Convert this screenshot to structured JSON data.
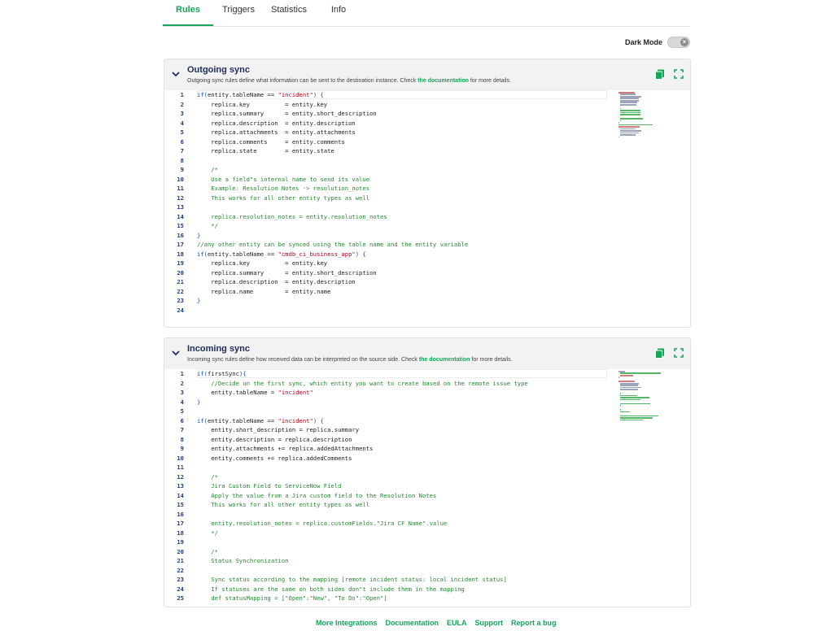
{
  "tabs": [
    {
      "label": "Rules",
      "active": true
    },
    {
      "label": "Triggers",
      "active": false
    },
    {
      "label": "Statistics",
      "active": false
    },
    {
      "label": "Info",
      "active": false
    }
  ],
  "dark_mode": {
    "label": "Dark Mode",
    "on": false
  },
  "accent_color": "#17a45b",
  "outgoing": {
    "title": "Outgoing sync",
    "desc_before": "Outgoing sync rules define what information can be sent to the destination instance. Check ",
    "desc_link": "the documentation",
    "desc_after": " for more details.",
    "lines": [
      [
        [
          "kw",
          "if("
        ],
        [
          "",
          "entity.tableName == "
        ],
        [
          "str",
          "\"incident\""
        ],
        [
          "kw",
          ") {"
        ]
      ],
      [
        [
          "",
          "    replica.key          = entity.key"
        ]
      ],
      [
        [
          "",
          "    replica.summary      = entity.short_description"
        ]
      ],
      [
        [
          "",
          "    replica.description  = entity.description"
        ]
      ],
      [
        [
          "",
          "    replica.attachments  = entity.attachments"
        ]
      ],
      [
        [
          "",
          "    replica.comments     = entity.comments"
        ]
      ],
      [
        [
          "",
          "    replica.state        = entity.state"
        ]
      ],
      [],
      [
        [
          "cm",
          "    /*"
        ]
      ],
      [
        [
          "cm",
          "    Use a field\"s internal name to send its value"
        ]
      ],
      [
        [
          "cm",
          "    Example: Resolution Notes -> resolution_notes"
        ]
      ],
      [
        [
          "cm",
          "    This works for all other entity types as well"
        ]
      ],
      [],
      [
        [
          "cm",
          "    replica.resolution_notes = entity.resolution_notes"
        ]
      ],
      [
        [
          "cm",
          "    */"
        ]
      ],
      [
        [
          "kw",
          "}"
        ]
      ],
      [
        [
          "cm",
          "//any other entity can be synced using the table name and the entity variable"
        ]
      ],
      [
        [
          "kw",
          "if("
        ],
        [
          "",
          "entity.tableName == "
        ],
        [
          "str",
          "\"cmdb_ci_business_app\""
        ],
        [
          "kw",
          ") {"
        ]
      ],
      [
        [
          "",
          "    replica.key          = entity.key"
        ]
      ],
      [
        [
          "",
          "    replica.summary      = entity.short_description"
        ]
      ],
      [
        [
          "",
          "    replica.description  = entity.description"
        ]
      ],
      [
        [
          "",
          "    replica.name         = entity.name"
        ]
      ],
      [
        [
          "kw",
          "}"
        ]
      ],
      []
    ]
  },
  "incoming": {
    "title": "Incoming sync",
    "desc_before": "Incoming sync rules define how received data can be interpreted on the source side. Check ",
    "desc_link": "the documentation",
    "desc_after": " for more details.",
    "lines": [
      [
        [
          "kw",
          "if("
        ],
        [
          "",
          "firstSync"
        ],
        [
          "kw",
          "){"
        ]
      ],
      [
        [
          "cm",
          "    //Decide on the first sync, which entity you want to create based on the remote issue type"
        ]
      ],
      [
        [
          "",
          "    entity.tableName = "
        ],
        [
          "str",
          "\"incident\""
        ]
      ],
      [
        [
          "kw",
          "}"
        ]
      ],
      [],
      [
        [
          "kw",
          "if("
        ],
        [
          "",
          "entity.tableName == "
        ],
        [
          "str",
          "\"incident\""
        ],
        [
          "kw",
          ") {"
        ]
      ],
      [
        [
          "",
          "    entity.short_description = replica.summary"
        ]
      ],
      [
        [
          "",
          "    entity.description = replica.description"
        ]
      ],
      [
        [
          "",
          "    entity.attachments += replica.addedAttachments"
        ]
      ],
      [
        [
          "",
          "    entity.comments += replica.addedComments"
        ]
      ],
      [],
      [
        [
          "cm",
          "    /*"
        ]
      ],
      [
        [
          "cm",
          "    Jira Custom Field to ServiceNow Field"
        ]
      ],
      [
        [
          "cm",
          "    Apply the value from a Jira custom field to the Resolution Notes"
        ]
      ],
      [
        [
          "cm",
          "    This works for all other entity types as well"
        ]
      ],
      [],
      [
        [
          "cm",
          "    entity.resolution_notes = replica.customFields.\"Jira CF Name\".value"
        ]
      ],
      [
        [
          "cm",
          "    */"
        ]
      ],
      [],
      [
        [
          "cm",
          "    /*"
        ]
      ],
      [
        [
          "cm",
          "    Status Synchronization"
        ]
      ],
      [],
      [
        [
          "cm",
          "    Sync status according to the mapping [remote incident status: local incident status]"
        ]
      ],
      [
        [
          "cm",
          "    If statuses are the same on both sides don\"t include them in the mapping"
        ]
      ],
      [
        [
          "cm",
          "    def statusMapping = [\"Open\":\"New\", \"To Do\":\"Open\"]"
        ]
      ]
    ]
  },
  "footer": [
    "More Integrations",
    "Documentation",
    "EULA",
    "Support",
    "Report a bug"
  ]
}
